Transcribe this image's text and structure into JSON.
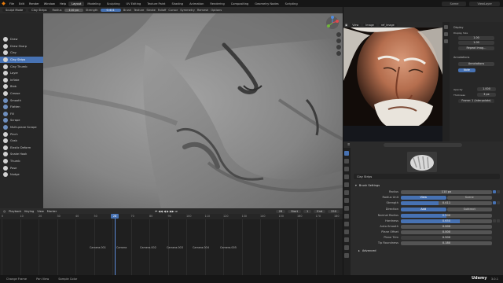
{
  "menubar": {
    "logo": "◆",
    "menus": [
      "File",
      "Edit",
      "Render",
      "Window",
      "Help"
    ],
    "workspaces": [
      {
        "label": "Layout",
        "active": true
      },
      {
        "label": "Modeling",
        "active": false
      },
      {
        "label": "Sculpting",
        "active": false
      },
      {
        "label": "UV Editing",
        "active": false
      },
      {
        "label": "Texture Paint",
        "active": false
      },
      {
        "label": "Shading",
        "active": false
      },
      {
        "label": "Animation",
        "active": false
      },
      {
        "label": "Rendering",
        "active": false
      },
      {
        "label": "Compositing",
        "active": false
      },
      {
        "label": "Geometry Nodes",
        "active": false
      },
      {
        "label": "Scripting",
        "active": false
      }
    ],
    "scene": "Scene",
    "view_layer": "ViewLayer"
  },
  "header": {
    "mode": "Sculpt Mode",
    "brush": "Clay Strips",
    "radius_label": "Radius",
    "radius_value": "110 px",
    "strength_label": "Strength",
    "strength_value": "0.411",
    "menus": [
      "Brush",
      "Texture",
      "Stroke",
      "Falloff",
      "Cursor"
    ],
    "symmetry": "Symmetry",
    "remesh": "Remesh",
    "options": "Options"
  },
  "toolbar": {
    "tools": [
      {
        "label": "Draw",
        "color": "#d2d2d2",
        "active": false
      },
      {
        "label": "Draw Sharp",
        "color": "#d2d2d2",
        "active": false
      },
      {
        "label": "Clay",
        "color": "#d2d2d2",
        "active": false
      },
      {
        "label": "Clay Strips",
        "color": "#d2d2d2",
        "active": true
      },
      {
        "label": "Clay Thumb",
        "color": "#d2d2d2",
        "active": false
      },
      {
        "label": "Layer",
        "color": "#d2d2d2",
        "active": false
      },
      {
        "label": "Inflate",
        "color": "#d2d2d2",
        "active": false
      },
      {
        "label": "Blob",
        "color": "#d2d2d2",
        "active": false
      },
      {
        "label": "Crease",
        "color": "#d2d2d2",
        "active": false
      },
      {
        "label": "Smooth",
        "color": "#6f8fbf",
        "active": false
      },
      {
        "label": "Flatten",
        "color": "#6f8fbf",
        "active": false
      },
      {
        "label": "Fill",
        "color": "#6f8fbf",
        "active": false
      },
      {
        "label": "Scrape",
        "color": "#6f8fbf",
        "active": false
      },
      {
        "label": "Multi-plane Scrape",
        "color": "#6f8fbf",
        "active": false
      },
      {
        "label": "Pinch",
        "color": "#d2d2d2",
        "active": false
      },
      {
        "label": "Grab",
        "color": "#d2d2d2",
        "active": false
      },
      {
        "label": "Elastic Deform",
        "color": "#d2d2d2",
        "active": false
      },
      {
        "label": "Snake Hook",
        "color": "#d2d2d2",
        "active": false
      },
      {
        "label": "Thumb",
        "color": "#d2d2d2",
        "active": false
      },
      {
        "label": "Pose",
        "color": "#d2d2d2",
        "active": false
      },
      {
        "label": "Nudge",
        "color": "#d2d2d2",
        "active": false
      }
    ]
  },
  "timeline": {
    "menus": [
      "Playback",
      "Keying",
      "View",
      "Marker"
    ],
    "transport": "⏮ ◀◀ ◀ ▶ ▶▶ ⏭",
    "start_label": "Start",
    "start": "1",
    "end_label": "End",
    "end": "250",
    "current_frame": "28",
    "ruler": [
      "0",
      "10",
      "20",
      "30",
      "40",
      "50",
      "60",
      "70",
      "80",
      "90",
      "100",
      "110",
      "120",
      "130",
      "140",
      "150",
      "160",
      "170",
      "180"
    ],
    "cameras": [
      "Camera.001",
      "Camera",
      "Camera.002",
      "Camera.003",
      "Camera.004",
      "Camera.005"
    ]
  },
  "image_editor": {
    "view": "View",
    "image": "Image",
    "name": "ref_image"
  },
  "ref_panel": {
    "display": "Display",
    "size_label": "Display Size",
    "size_x": "1.00",
    "size_y": "1.00",
    "repeat": "Repeat Imag…",
    "annotations": "Annotations",
    "annotation_layer": "Annotations",
    "note": "Note",
    "opacity_label": "Opacity",
    "opacity": "1.000",
    "thickness_label": "Thickness",
    "thickness": "3 px",
    "frame_label": "Frame: 1 (interpolate)"
  },
  "properties": {
    "brush_name": "Clay Strips",
    "brush_settings": "Brush Settings",
    "radius_label": "Radius",
    "radius_value": "110 px",
    "radius_unit_label": "Radius Unit",
    "radius_unit_view": "View",
    "radius_unit_scene": "Scene",
    "strength_label": "Strength",
    "strength_value": "0.411",
    "direction_label": "Direction",
    "direction_add": "Add",
    "direction_sub": "Subtract",
    "normal_radius_label": "Normal Radius",
    "normal_radius_value": "0.500",
    "hardness_label": "Hardness",
    "hardness_value": "0.650",
    "autosmooth_label": "Auto-Smooth",
    "autosmooth_value": "0.000",
    "plane_offset_label": "Plane Offset",
    "plane_offset_value": "0.000",
    "plane_trim_label": "Plane Trim",
    "plane_trim_value": "0.500",
    "tip_roundness_label": "Tip Roundness",
    "tip_roundness_value": "0.180",
    "advanced": "Advanced",
    "strength_fraction": 0.411,
    "hardness_fraction": 0.65,
    "normal_radius_fraction": 0.5
  },
  "statusbar": {
    "left": "Change Frame",
    "middle": "Pan View",
    "right": "Sample Color",
    "version": "3.0.1"
  },
  "watermark": "Udemy"
}
